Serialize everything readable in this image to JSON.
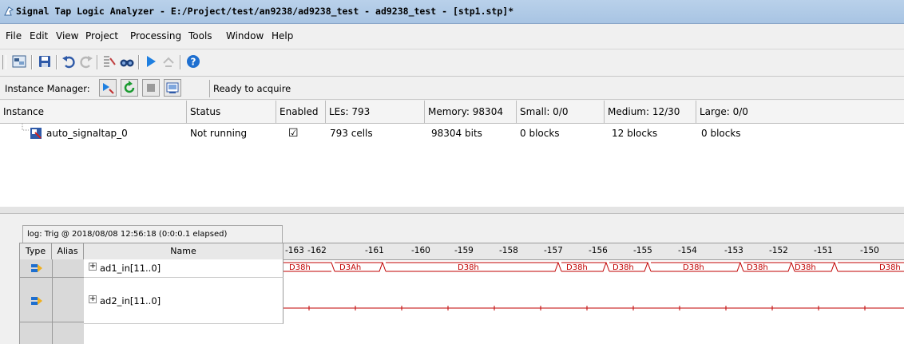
{
  "window": {
    "title": "Signal Tap Logic Analyzer - E:/Project/test/an9238/ad9238_test - ad9238_test - [stp1.stp]*"
  },
  "menu": [
    "File",
    "Edit",
    "View",
    "Project",
    "Processing",
    "Tools",
    "Window",
    "Help"
  ],
  "toolbar": {
    "buttons": [
      "setup-icon",
      "save-icon",
      "undo-icon",
      "redo-icon",
      "node-finder-icon",
      "find-icon",
      "run-icon",
      "stop-icon",
      "help-icon"
    ]
  },
  "instance_manager": {
    "label": "Instance Manager:",
    "status": "Ready to acquire"
  },
  "instances": {
    "headers": [
      "Instance",
      "Status",
      "Enabled",
      "LEs: 793",
      "Memory: 98304",
      "Small: 0/0",
      "Medium: 12/30",
      "Large: 0/0"
    ],
    "rows": [
      {
        "name": "auto_signaltap_0",
        "status": "Not running",
        "enabled": "☑",
        "les": "793 cells",
        "memory": "98304 bits",
        "small": "0 blocks",
        "medium": "12 blocks",
        "large": "0 blocks"
      }
    ]
  },
  "log": {
    "tab": "log: Trig @ 2018/08/08 12:56:18 (0:0:0.1 elapsed)"
  },
  "signals": {
    "headers": {
      "type": "Type",
      "alias": "Alias",
      "name": "Name"
    },
    "rows": [
      {
        "name": "ad1_in[11..0]"
      },
      {
        "name": "ad2_in[11..0]"
      }
    ],
    "ticks": [
      "-163",
      "-162",
      "-161",
      "-160",
      "-159",
      "-158",
      "-157",
      "-156",
      "-155",
      "-154",
      "-153",
      "-152",
      "-151",
      "-150"
    ],
    "bus_values": [
      "D38h",
      "D3Ah",
      "D38h",
      "D38h",
      "D38h",
      "D38h",
      "D38h",
      "D38h",
      "D38h"
    ]
  }
}
